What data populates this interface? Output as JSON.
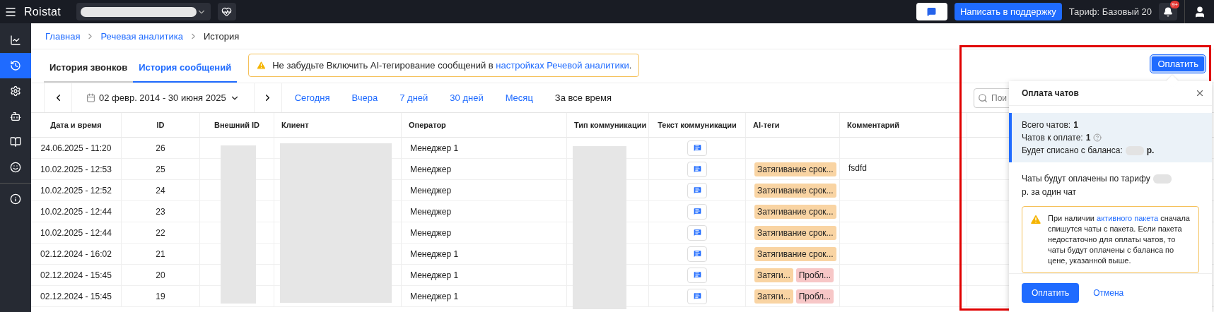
{
  "topbar": {
    "logo": "Roistat",
    "support_button": "Написать в поддержку",
    "tariff": "Тариф: Базовый 20",
    "notifications_badge": "9+"
  },
  "sidebar": {
    "items": [
      {
        "selected": false
      },
      {
        "selected": true
      },
      {
        "selected": false
      },
      {
        "selected": false
      },
      {
        "selected": false
      },
      {
        "selected": false
      },
      {
        "selected": false
      }
    ]
  },
  "breadcrumbs": [
    {
      "label": "Главная",
      "link": true
    },
    {
      "label": "Речевая аналитика",
      "link": true
    },
    {
      "label": "История",
      "link": false
    }
  ],
  "tabs": [
    {
      "label": "История звонков",
      "selected": false
    },
    {
      "label": "История сообщений",
      "selected": true
    }
  ],
  "alert": {
    "text": "Не забудьте Включить AI-тегирование сообщений в",
    "link": "настройках Речевой аналитики",
    "end": "."
  },
  "pay_button": "Оплатить",
  "filters": {
    "date_range": "02 февр. 2014 - 30 июня 2025",
    "quick": [
      {
        "label": "Сегодня",
        "selected": false
      },
      {
        "label": "Вчера",
        "selected": false
      },
      {
        "label": "7 дней",
        "selected": false
      },
      {
        "label": "30 дней",
        "selected": false
      },
      {
        "label": "Месяц",
        "selected": false
      },
      {
        "label": "За все время",
        "selected": true
      }
    ],
    "search_placeholder": "Пои"
  },
  "table": {
    "columns": [
      "Дата и время",
      "ID",
      "Внешний ID",
      "Клиент",
      "Оператор",
      "Тип коммуникации",
      "Текст коммуникации",
      "AI-теги",
      "Комментарий"
    ],
    "rows": [
      {
        "date": "24.06.2025 - 11:20",
        "id": "26",
        "operator": "Менеджер 1",
        "tags": [],
        "comment": ""
      },
      {
        "date": "10.02.2025 - 12:53",
        "id": "25",
        "operator": "Менеджер",
        "tags": [
          {
            "label": "Затягивание срок...",
            "color": "#f9d4a3"
          }
        ],
        "comment": "fsdfd"
      },
      {
        "date": "10.02.2025 - 12:52",
        "id": "24",
        "operator": "Менеджер",
        "tags": [
          {
            "label": "Затягивание срок...",
            "color": "#f9d4a3"
          }
        ],
        "comment": ""
      },
      {
        "date": "10.02.2025 - 12:44",
        "id": "23",
        "operator": "Менеджер",
        "tags": [
          {
            "label": "Затягивание срок...",
            "color": "#f9d4a3"
          }
        ],
        "comment": ""
      },
      {
        "date": "10.02.2025 - 12:44",
        "id": "22",
        "operator": "Менеджер",
        "tags": [
          {
            "label": "Затягивание срок...",
            "color": "#f9d4a3"
          }
        ],
        "comment": ""
      },
      {
        "date": "02.12.2024 - 16:02",
        "id": "21",
        "operator": "Менеджер 1",
        "tags": [
          {
            "label": "Затягивание срок...",
            "color": "#f9d4a3"
          }
        ],
        "comment": ""
      },
      {
        "date": "02.12.2024 - 15:45",
        "id": "20",
        "operator": "Менеджер 1",
        "tags": [
          {
            "label": "Затяги...",
            "color": "#f9d4a3"
          },
          {
            "label": "Пробл...",
            "color": "#f7c7c7"
          }
        ],
        "comment": ""
      },
      {
        "date": "02.12.2024 - 15:45",
        "id": "19",
        "operator": "Менеджер 1",
        "tags": [
          {
            "label": "Затяги...",
            "color": "#f9d4a3"
          },
          {
            "label": "Пробл...",
            "color": "#f7c7c7"
          }
        ],
        "comment": ""
      }
    ]
  },
  "popup": {
    "title": "Оплата чатов",
    "total_label": "Всего чатов:",
    "total": "1",
    "to_pay_label": "Чатов к оплате:",
    "to_pay": "1",
    "balance_label": "Будет списано с баланса:",
    "balance_unit": "р.",
    "tariff_text": "Чаты будут оплачены по тарифу",
    "tariff_end": "р. за один чат",
    "warning_start": "При наличии",
    "warning_link": "активного пакета",
    "warning_rest": "сначала спишутся чаты с пакета. Если пакета недостаточно для оплаты чатов, то чаты будут оплачены с баланса по цене, указанной выше.",
    "pay": "Оплатить",
    "cancel": "Отмена"
  }
}
